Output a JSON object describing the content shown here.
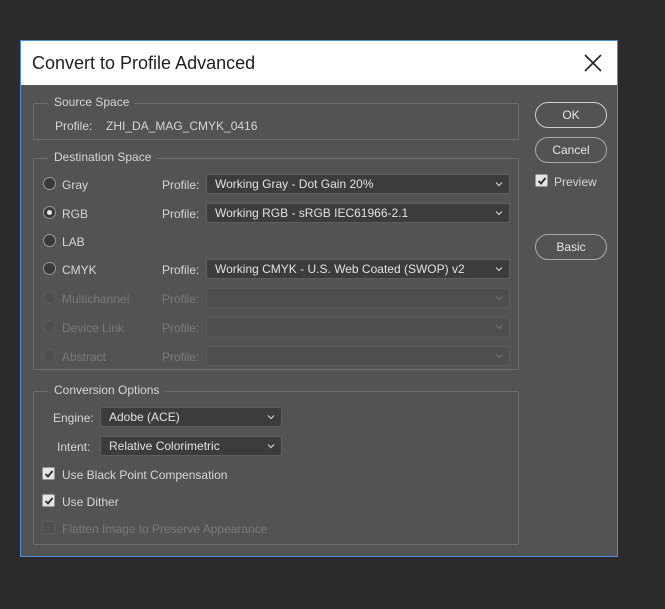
{
  "dialog": {
    "title": "Convert to Profile Advanced"
  },
  "source": {
    "legend": "Source Space",
    "profile_label": "Profile:",
    "profile_value": "ZHI_DA_MAG_CMYK_0416"
  },
  "destination": {
    "legend": "Destination Space",
    "profile_label": "Profile:",
    "rows": [
      {
        "label": "Gray",
        "profile": "Working Gray - Dot Gain 20%"
      },
      {
        "label": "RGB",
        "profile": "Working RGB - sRGB IEC61966-2.1"
      },
      {
        "label": "LAB",
        "profile": ""
      },
      {
        "label": "CMYK",
        "profile": "Working CMYK - U.S. Web Coated (SWOP) v2"
      },
      {
        "label": "Multichannel",
        "profile": ""
      },
      {
        "label": "Device Link",
        "profile": ""
      },
      {
        "label": "Abstract",
        "profile": ""
      }
    ],
    "selected": "RGB"
  },
  "conversion": {
    "legend": "Conversion Options",
    "engine_label": "Engine:",
    "engine_value": "Adobe (ACE)",
    "intent_label": "Intent:",
    "intent_value": "Relative Colorimetric",
    "black_point_label": "Use Black Point Compensation",
    "black_point_checked": true,
    "dither_label": "Use Dither",
    "dither_checked": true,
    "flatten_label": "Flatten Image to Preserve Appearance",
    "flatten_checked": false
  },
  "buttons": {
    "ok": "OK",
    "cancel": "Cancel",
    "preview_label": "Preview",
    "preview_checked": true,
    "basic": "Basic"
  },
  "colors": {
    "dialog_bg": "#535353",
    "title_bg": "#ffffff",
    "border_accent": "#4a90d9"
  }
}
